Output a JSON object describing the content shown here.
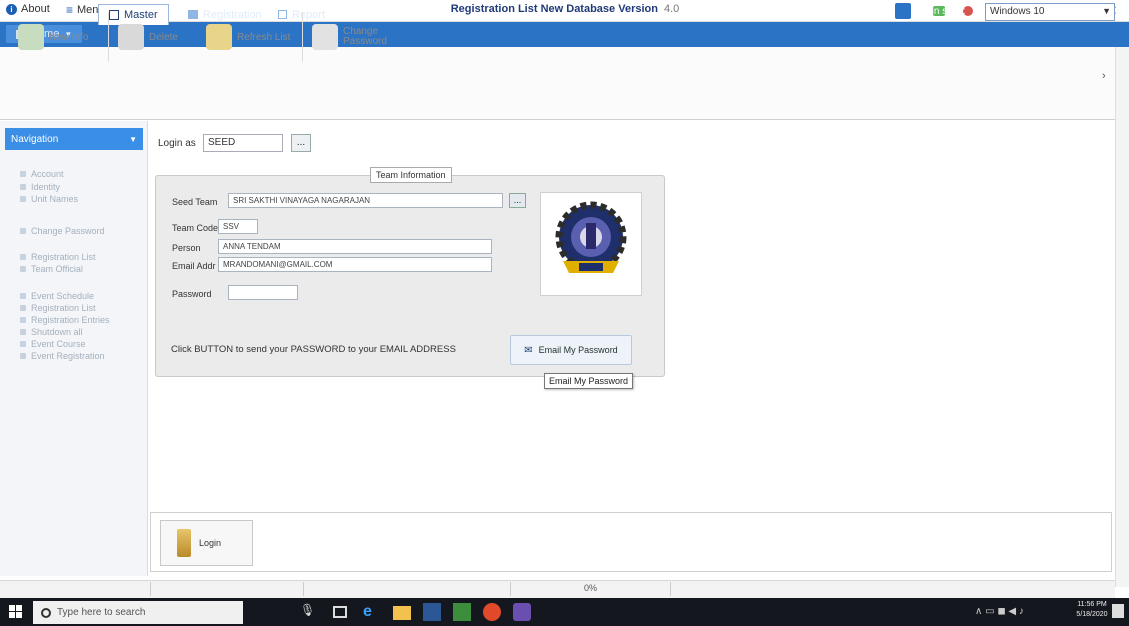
{
  "window": {
    "about_label": "About",
    "menu_label": "Menu",
    "title": "Registration List  New Database Version",
    "version": "4.0",
    "skin_label": "Skin style:",
    "skin_value": "Windows 10"
  },
  "tabs": [
    {
      "label": "Home"
    },
    {
      "label": "Master"
    },
    {
      "label": "Registration"
    },
    {
      "label": "Report"
    }
  ],
  "ribbon": {
    "buttons": [
      {
        "label": "New Info"
      },
      {
        "label": "Delete"
      },
      {
        "label": "Refresh List"
      },
      {
        "label": "Change Password"
      }
    ]
  },
  "sidebar": {
    "header": "Navigation",
    "items": [
      "Account",
      "Identity",
      "Unit Names",
      "Change Password",
      "Registration List",
      "Team Official",
      "Event Schedule",
      "Registration List",
      "Registration Entries",
      "Shutdown all",
      "Event Course",
      "Event Registration"
    ]
  },
  "login": {
    "login_as_label": "Login as",
    "login_as_value": "SEED",
    "login_as_btn": "..."
  },
  "team": {
    "legend": "Team Information",
    "seed_team_label": "Seed Team",
    "seed_team_value": "SRI SAKTHI VINAYAGA NAGARAJAN",
    "seed_btn": "...",
    "team_code_label": "Team Code",
    "team_code_value": "SSV",
    "person_label": "Person",
    "person_value": "ANNA TENDAM",
    "email_label": "Email Addr",
    "email_value": "MRANDOMANI@GMAIL.COM",
    "password_label": "Password",
    "password_value": ""
  },
  "email_section": {
    "instruction": "Click BUTTON to send your PASSWORD to your EMAIL ADDRESS",
    "button_label": "Email My Password",
    "tooltip": "Email My Password"
  },
  "bottom": {
    "login_label": "Login"
  },
  "status": {
    "progress_text": "0%"
  },
  "taskbar": {
    "search_placeholder": "Type here to search",
    "time": "11:56 PM",
    "date": "5/18/2020"
  },
  "colors": {
    "tab_bar": "#2b73c4",
    "sidebar_header": "#3a8ee6",
    "title_text": "#1f3a7a",
    "taskbar": "#14181e"
  }
}
